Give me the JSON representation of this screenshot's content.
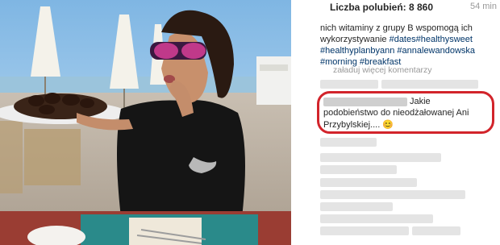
{
  "header": {
    "likes": "Liczba polubień: 8 860",
    "time": "54 min"
  },
  "caption": {
    "line1": "nich witaminy z grupy B wspomogą ich",
    "line2_text": "wykorzystywanie ",
    "line2_tags": "#dates#healthysweet",
    "line3": "#healthyplanbyann #annalewandowska",
    "line4": "#morning #breakfast"
  },
  "load_more": "załaduj więcej komentarzy",
  "highlighted_comment": {
    "line1": "Jakie",
    "line2": "podobieństwo do nieodżałowanej Ani",
    "line3": "Przybylskiej.... 😊"
  },
  "colors": {
    "highlight_border": "#d2242b",
    "hashtag": "#003569"
  }
}
